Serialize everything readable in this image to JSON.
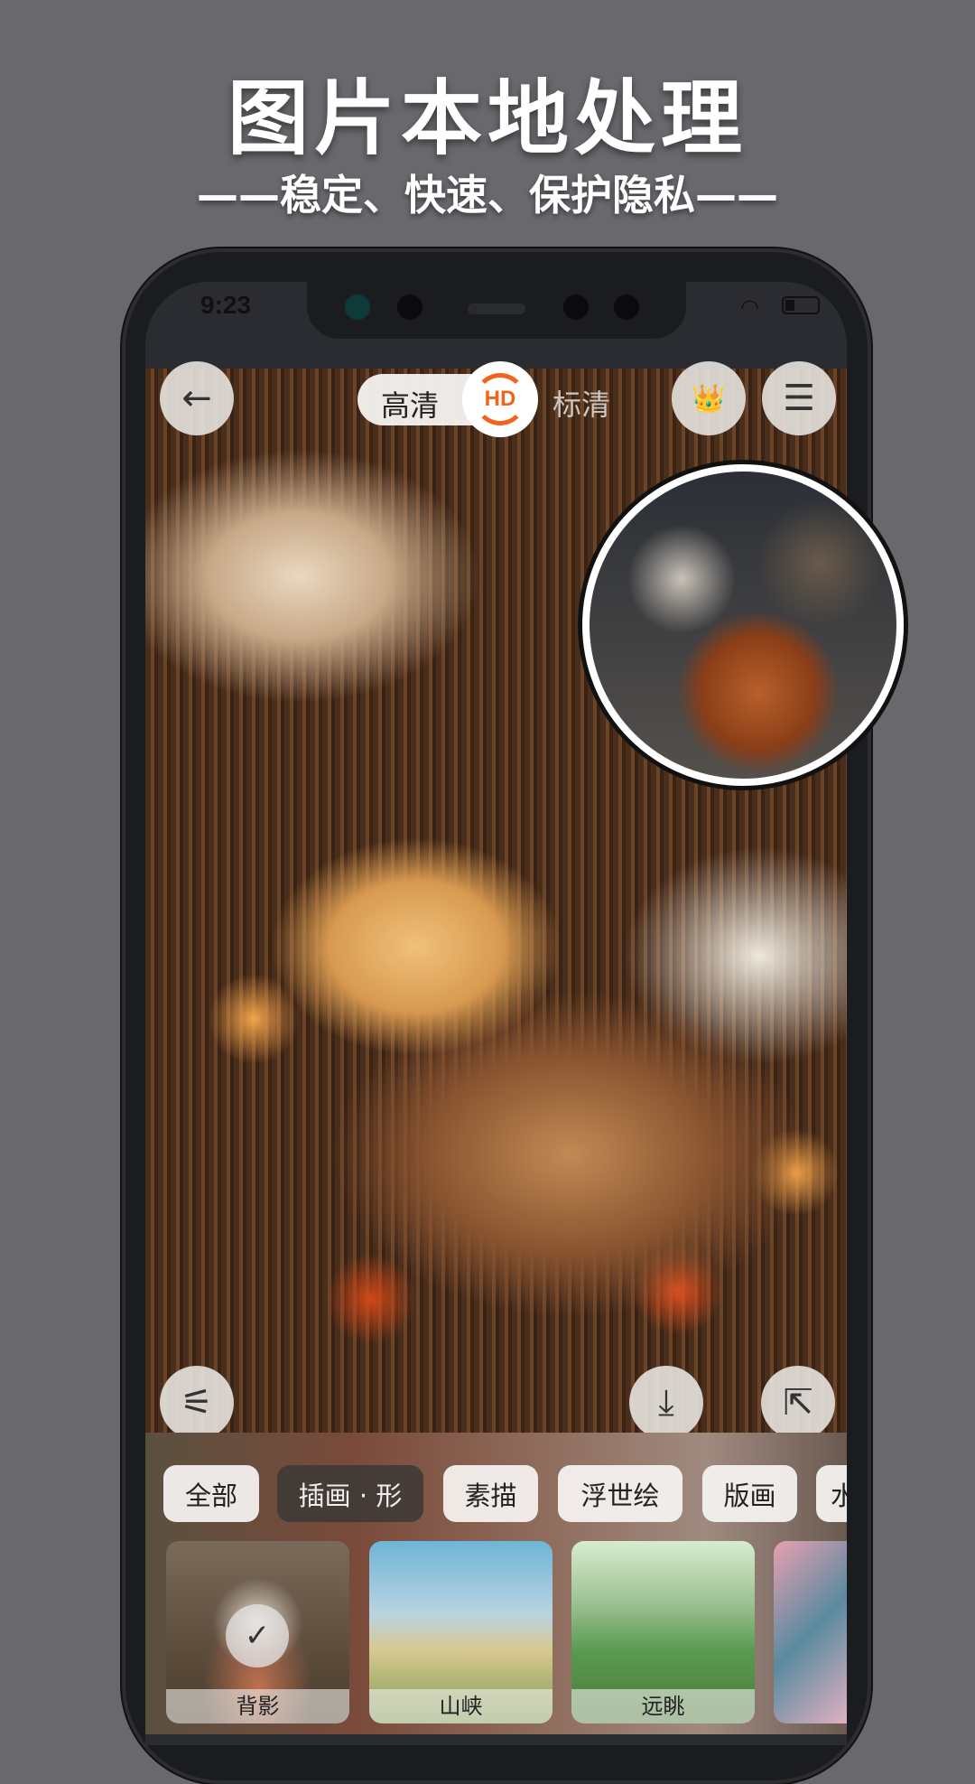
{
  "promo": {
    "title": "图片本地处理",
    "subtitle": "——稳定、快速、保护隐私——"
  },
  "status_bar": {
    "time": "9:23",
    "wifi_icon": "wifi-icon",
    "battery_icon": "battery-icon"
  },
  "top_bar": {
    "hd_label": "高清",
    "hd_badge": "HD",
    "sd_label": "标清",
    "accent": "#f0641e"
  },
  "toolbar": {
    "back_icon": "←",
    "menu_icon": "☰",
    "crown_icon": "👑",
    "adjust_icon": "⚟",
    "download_icon": "⤓",
    "share_icon": "⇱"
  },
  "categories": [
    {
      "label": "全部"
    },
    {
      "label": "插画 · 形",
      "active": true
    },
    {
      "label": "素描"
    },
    {
      "label": "浮世绘"
    },
    {
      "label": "版画"
    },
    {
      "label": "水"
    }
  ],
  "styles": [
    {
      "label": "背影",
      "selected": true
    },
    {
      "label": "山峡"
    },
    {
      "label": "远眺"
    },
    {
      "label": ""
    }
  ]
}
